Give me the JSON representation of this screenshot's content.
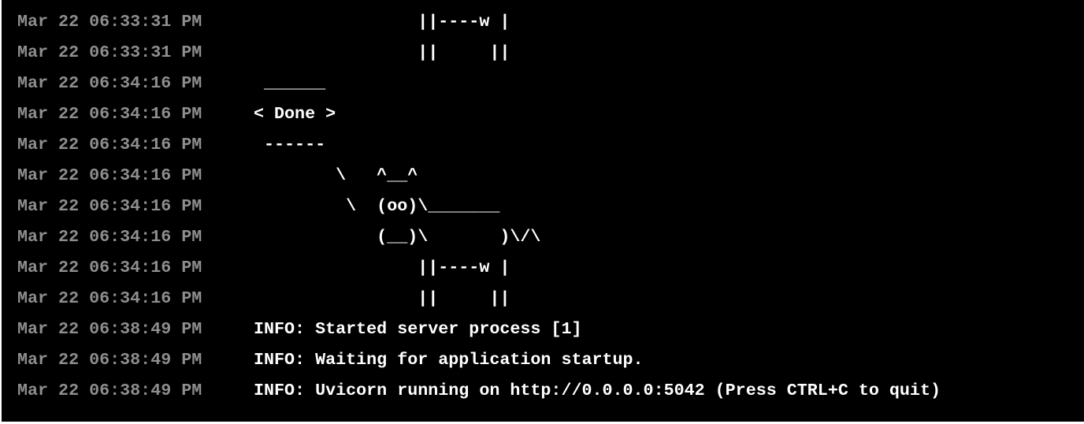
{
  "terminal": {
    "colors": {
      "background": "#000000",
      "timestamp": "#8e8e8e",
      "message": "#ffffff"
    },
    "lines": [
      {
        "timestamp": "Mar 22 06:33:31 PM",
        "message": "                ||----w |"
      },
      {
        "timestamp": "Mar 22 06:33:31 PM",
        "message": "                ||     ||"
      },
      {
        "timestamp": "Mar 22 06:34:16 PM",
        "message": " ______"
      },
      {
        "timestamp": "Mar 22 06:34:16 PM",
        "message": "< Done >"
      },
      {
        "timestamp": "Mar 22 06:34:16 PM",
        "message": " ------"
      },
      {
        "timestamp": "Mar 22 06:34:16 PM",
        "message": "        \\   ^__^"
      },
      {
        "timestamp": "Mar 22 06:34:16 PM",
        "message": "         \\  (oo)\\_______"
      },
      {
        "timestamp": "Mar 22 06:34:16 PM",
        "message": "            (__)\\       )\\/\\"
      },
      {
        "timestamp": "Mar 22 06:34:16 PM",
        "message": "                ||----w |"
      },
      {
        "timestamp": "Mar 22 06:34:16 PM",
        "message": "                ||     ||"
      },
      {
        "timestamp": "Mar 22 06:38:49 PM",
        "message": "INFO: Started server process [1]"
      },
      {
        "timestamp": "Mar 22 06:38:49 PM",
        "message": "INFO: Waiting for application startup."
      },
      {
        "timestamp": "Mar 22 06:38:49 PM",
        "message": "INFO: Uvicorn running on http://0.0.0.0:5042 (Press CTRL+C to quit)"
      }
    ]
  }
}
